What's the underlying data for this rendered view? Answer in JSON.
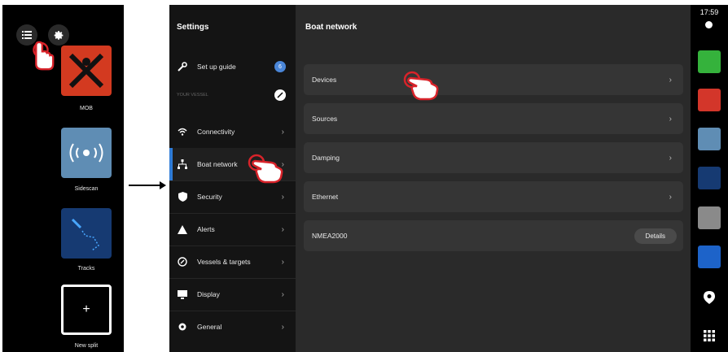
{
  "home": {
    "tiles": [
      {
        "label": "MOB"
      },
      {
        "label": "Sidescan"
      },
      {
        "label": "Tracks"
      },
      {
        "label": "New split",
        "glyph": "+"
      }
    ]
  },
  "settings": {
    "title": "Settings",
    "items": [
      {
        "label": "Set up guide",
        "badge": "6",
        "icon": "wrench-icon"
      },
      {
        "section": "YOUR VESSEL"
      },
      {
        "label": "Connectivity",
        "icon": "wifi-icon"
      },
      {
        "label": "Boat network",
        "icon": "network-icon"
      },
      {
        "label": "Security",
        "icon": "shield-icon"
      },
      {
        "label": "Alerts",
        "icon": "warning-icon"
      },
      {
        "label": "Vessels & targets",
        "icon": "target-icon"
      },
      {
        "label": "Display",
        "icon": "display-icon"
      },
      {
        "label": "General",
        "icon": "gear-icon"
      }
    ]
  },
  "main": {
    "title": "Boat network",
    "rows": [
      {
        "label": "Devices"
      },
      {
        "label": "Sources"
      },
      {
        "label": "Damping"
      },
      {
        "label": "Ethernet"
      },
      {
        "label": "NMEA2000",
        "button": "Details"
      }
    ]
  },
  "rail": {
    "time": "17:59"
  },
  "colors": {
    "accent": "#2e7bd6",
    "hand": "#d8232a"
  }
}
